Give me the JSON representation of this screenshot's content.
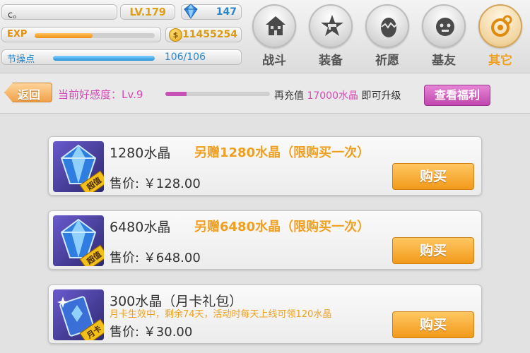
{
  "player": {
    "name": "c。",
    "level": "LV.179",
    "gems": "147",
    "exp_label": "EXP",
    "exp_fraction": 0.48,
    "gold": "11455254",
    "gold_icon": "coin-icon",
    "stamina_label": "节操点",
    "stamina_text": "106/106",
    "stamina_fraction": 1.0
  },
  "nav": [
    {
      "label": "战斗",
      "icon": "house-icon"
    },
    {
      "label": "装备",
      "icon": "gun-star-icon"
    },
    {
      "label": "祈愿",
      "icon": "egg-icon"
    },
    {
      "label": "基友",
      "icon": "face-icon"
    },
    {
      "label": "其它",
      "icon": "gear-icon"
    }
  ],
  "subheader": {
    "back_label": "返回",
    "favor_label": "当前好感度：Lv.9",
    "favor_fraction": 0.2,
    "recharge_prefix": "再充值",
    "recharge_amount": "17000水晶",
    "recharge_suffix": "即可升级",
    "benefit_button": "查看福利"
  },
  "items": [
    {
      "name": "1280水晶",
      "bonus": "另赠1280水晶（限购买一次）",
      "price": "售价: ￥128.00",
      "tag": "超值",
      "buy_label": "购买"
    },
    {
      "name": "6480水晶",
      "bonus": "另赠6480水晶（限购买一次）",
      "price": "售价: ￥648.00",
      "tag": "超值",
      "buy_label": "购买"
    },
    {
      "name": "300水晶（月卡礼包）",
      "desc": "月卡生效中，剩余74天，活动时每天上线可领120水晶",
      "price": "售价: ￥30.00",
      "tag": "月卡",
      "buy_label": "购买"
    }
  ],
  "colors": {
    "accent_orange": "#f0a020",
    "accent_pink": "#d44bb4",
    "accent_blue": "#2a86c9"
  }
}
